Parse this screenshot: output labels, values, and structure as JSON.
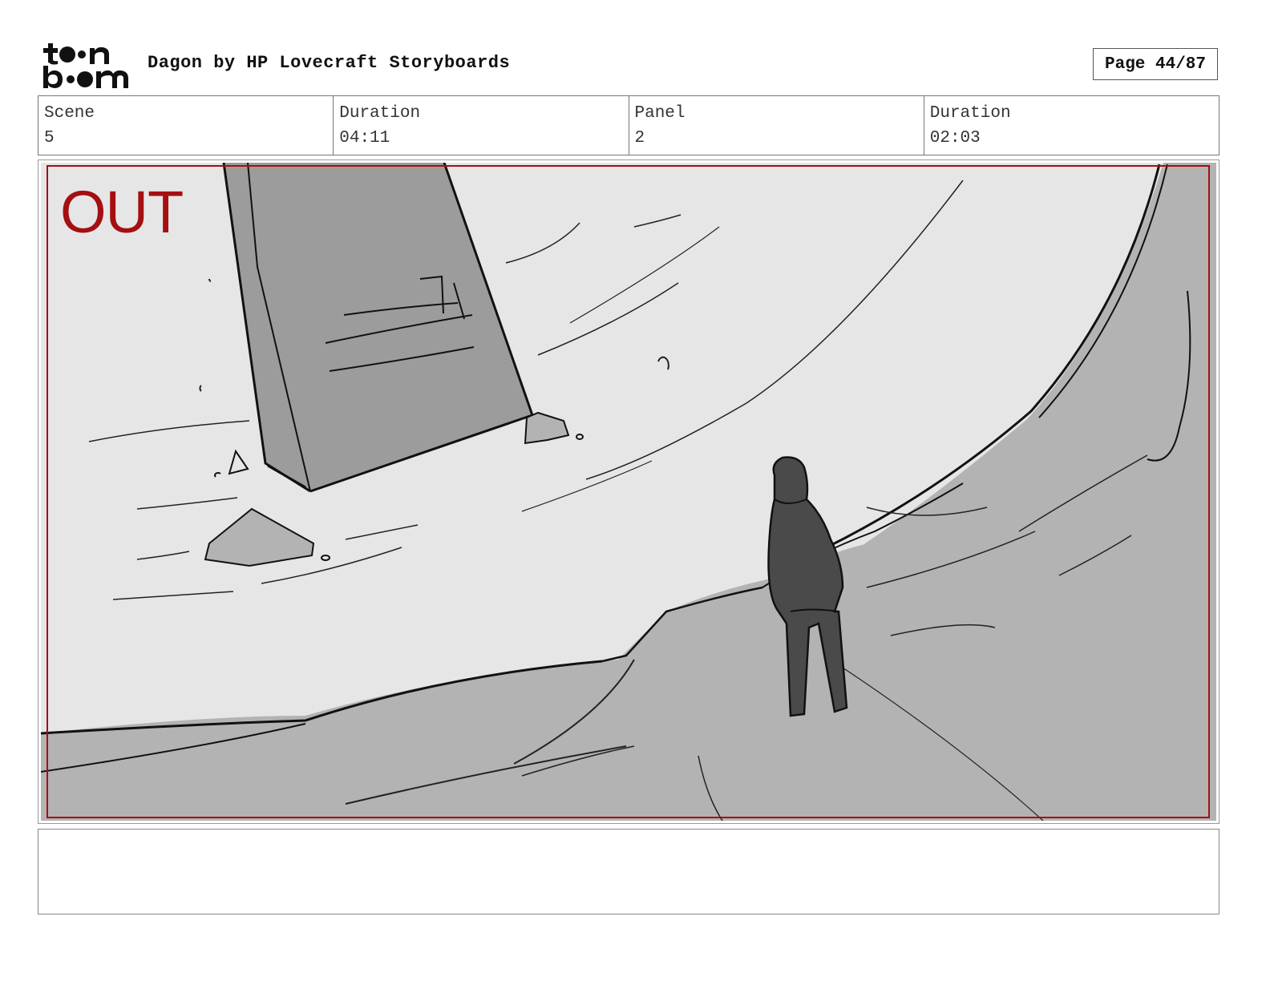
{
  "header": {
    "logo_text": "toon boom",
    "title": "Dagon by HP Lovecraft Storyboards",
    "page": "Page 44/87"
  },
  "info": {
    "scene_label": "Scene",
    "scene_value": "5",
    "scene_duration_label": "Duration",
    "scene_duration_value": "04:11",
    "panel_label": "Panel",
    "panel_value": "2",
    "panel_duration_label": "Duration",
    "panel_duration_value": "02:03"
  },
  "panel": {
    "transition_text": "OUT",
    "transition_color": "#a40f12",
    "safe_frame_color": "#a40f12",
    "sky_color": "#e6e6e6",
    "ground_color": "#b3b3b3",
    "monolith_color": "#9c9c9c",
    "figure_color": "#4a4a4a"
  },
  "notes": {
    "text": ""
  }
}
